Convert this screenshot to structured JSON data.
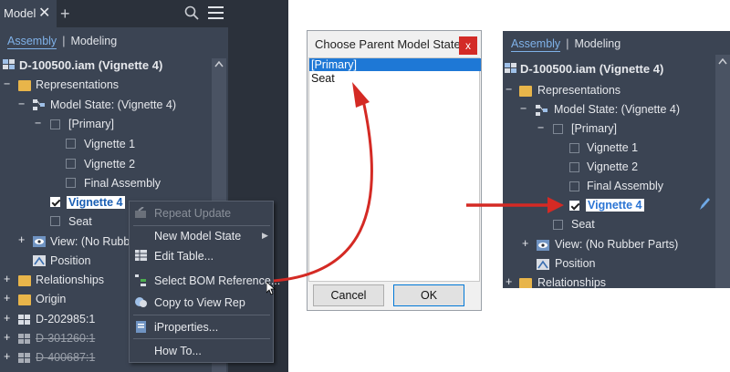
{
  "left_panel": {
    "tab_label": "Model",
    "tab_close": "✕",
    "add_tab": "+",
    "segments": {
      "assembly": "Assembly",
      "modeling": "Modeling"
    },
    "tree": {
      "root": "D-100500.iam (Vignette 4)",
      "representations": "Representations",
      "model_state": "Model State: (Vignette 4)",
      "primary": "[Primary]",
      "vignette1": "Vignette 1",
      "vignette2": "Vignette 2",
      "final_assembly": "Final Assembly",
      "vignette4": "Vignette 4",
      "seat": "Seat",
      "view": "View: (No Rubber",
      "position": "Position",
      "relationships": "Relationships",
      "origin": "Origin",
      "part1": "D-202985:1",
      "part2": "D-301260:1",
      "part3": "D-400687:1"
    }
  },
  "context_menu": {
    "repeat_update": "Repeat Update",
    "new_model_state": "New Model State",
    "edit_table": "Edit Table...",
    "select_bom": "Select BOM Reference...",
    "copy_view": "Copy to View Rep",
    "iproperties": "iProperties...",
    "how_to": "How To..."
  },
  "dialog": {
    "title": "Choose Parent Model State",
    "close": "x",
    "items": [
      "[Primary]",
      "Seat"
    ],
    "cancel": "Cancel",
    "ok": "OK"
  },
  "right_panel": {
    "segments": {
      "assembly": "Assembly",
      "modeling": "Modeling"
    },
    "tree": {
      "root": "D-100500.iam (Vignette 4)",
      "representations": "Representations",
      "model_state": "Model State: (Vignette 4)",
      "primary": "[Primary]",
      "vignette1": "Vignette 1",
      "vignette2": "Vignette 2",
      "final_assembly": "Final Assembly",
      "vignette4": "Vignette 4",
      "seat": "Seat",
      "view": "View: (No Rubber Parts)",
      "position": "Position",
      "relationships": "Relationships"
    }
  },
  "colors": {
    "panel": "#3b4453",
    "arrow": "#d42a24",
    "accent": "#7fb1e8"
  }
}
